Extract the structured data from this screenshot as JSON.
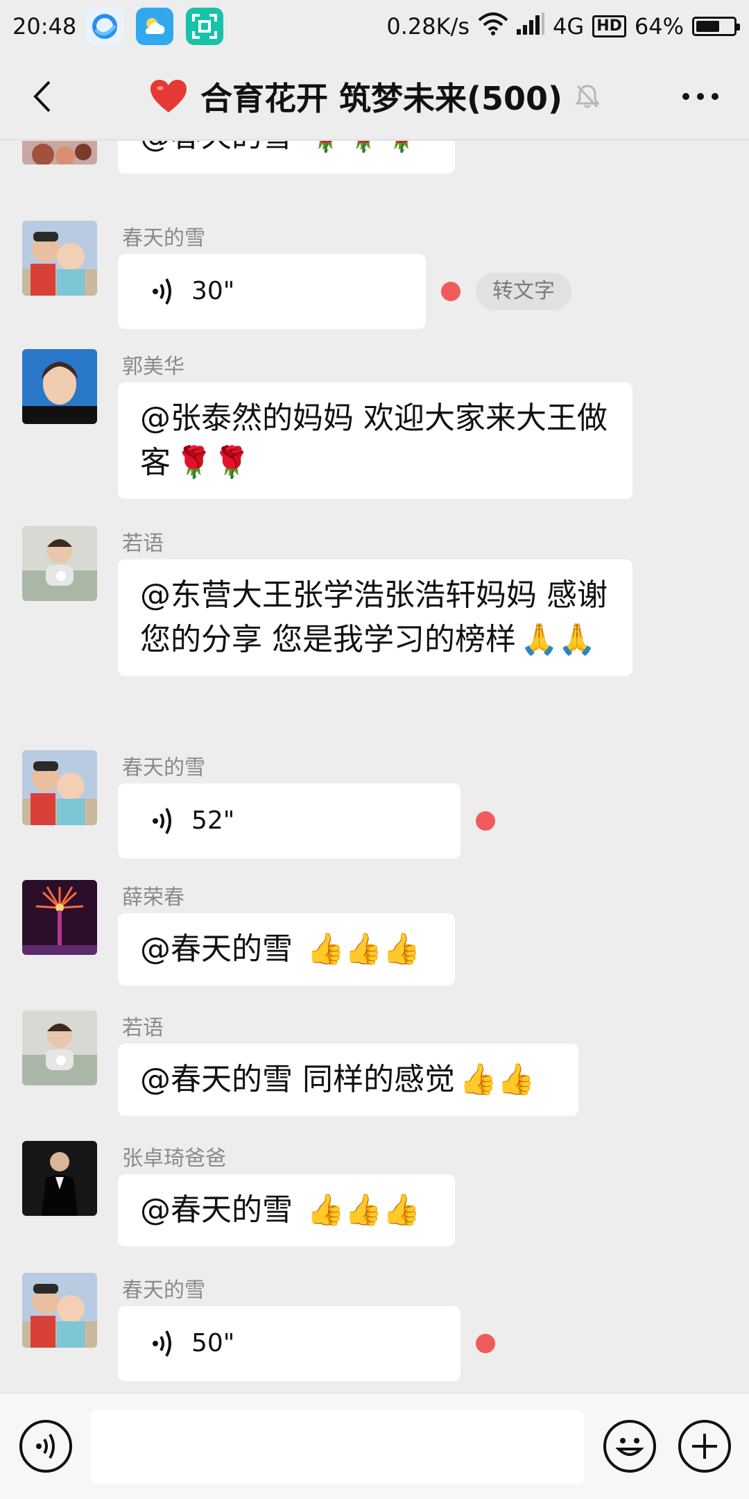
{
  "status_bar": {
    "time": "20:48",
    "net_speed": "0.28K/s",
    "network": "4G",
    "hd": "HD",
    "battery": "64%",
    "battery_level": 0.64
  },
  "header": {
    "title": "合育花开 筑梦未来(500)",
    "title_icon": "heart",
    "mute_icon": "bell-off"
  },
  "messages": [
    {
      "type": "text",
      "sender": "",
      "text": "@春天的雪 ",
      "emoji": "🌹🌹🌹"
    },
    {
      "type": "voice",
      "sender": "春天的雪",
      "duration": "30\"",
      "unread": true,
      "to_text": "转文字"
    },
    {
      "type": "text",
      "sender": "郭美华",
      "text": "@张泰然的妈妈  欢迎大家来大王做客",
      "emoji": "🌹🌹"
    },
    {
      "type": "text",
      "sender": "若语",
      "text": "@东营大王张学浩张浩轩妈妈  感谢您的分享 您是我学习的榜样",
      "emoji": "🙏🙏"
    },
    {
      "type": "voice",
      "sender": "春天的雪",
      "duration": "52\"",
      "unread": true
    },
    {
      "type": "text",
      "sender": "薛荣春",
      "text": "@春天的雪 ",
      "emoji": "👍👍👍"
    },
    {
      "type": "text",
      "sender": "若语",
      "text": "@春天的雪  同样的感觉",
      "emoji": "👍👍"
    },
    {
      "type": "text",
      "sender": "张卓琦爸爸",
      "text": "@春天的雪 ",
      "emoji": "👍👍👍"
    },
    {
      "type": "voice",
      "sender": "春天的雪",
      "duration": "50\"",
      "unread": true
    }
  ],
  "input_bar": {
    "voice_icon": "voice-icon",
    "emoji_icon": "emoji-icon",
    "plus_icon": "plus-icon"
  },
  "colors": {
    "background": "#ededed",
    "bubble": "#ffffff",
    "unread_dot": "#f25b5b",
    "heart": "#e53935"
  }
}
